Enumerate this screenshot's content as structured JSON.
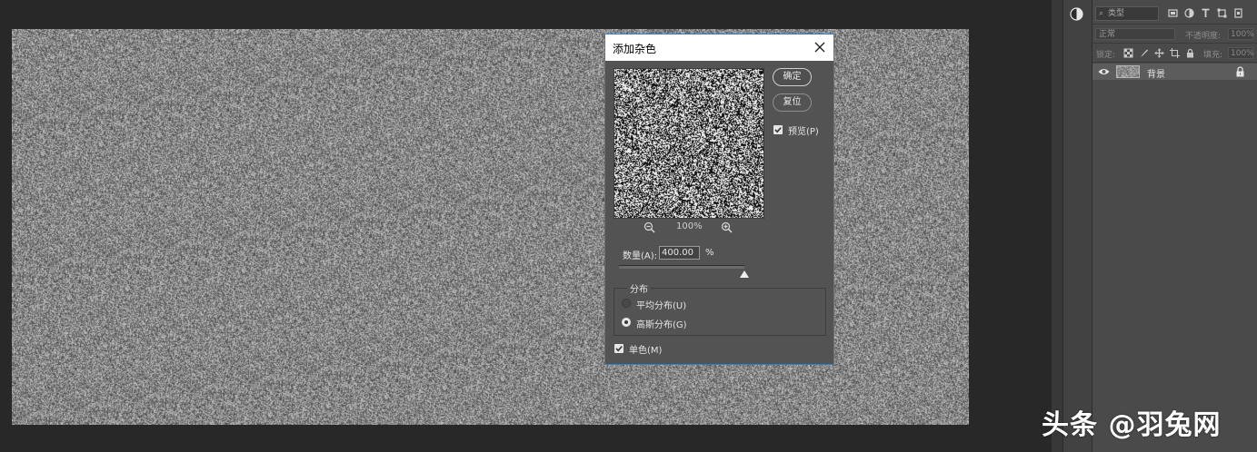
{
  "dialog": {
    "title": "添加杂色",
    "ok_label": "确定",
    "reset_label": "复位",
    "preview_label": "预览(P)",
    "preview_checked": true,
    "zoom_level": "100%",
    "amount_label": "数量(A):",
    "amount_value": "400.00",
    "amount_unit": "%",
    "amount_slider_fraction": 1.0,
    "distribution": {
      "legend": "分布",
      "uniform_label": "平均分布(U)",
      "gaussian_label": "高斯分布(G)",
      "selected": "gaussian"
    },
    "monochromatic_label": "单色(M)",
    "monochromatic_checked": true
  },
  "layers_panel": {
    "filter_kind": "类型",
    "blend_mode": "正常",
    "opacity_label": "不透明度:",
    "opacity_value": "100%",
    "lock_label": "锁定:",
    "fill_label": "填充:",
    "fill_value": "100%",
    "layers": [
      {
        "name": "背景",
        "visible": true,
        "locked": true
      }
    ]
  },
  "icons": {
    "adjust": "half-circle-icon",
    "close": "close-icon",
    "zoom_out": "zoom-out-icon",
    "zoom_in": "zoom-in-icon",
    "eye": "eye-icon",
    "lock": "lock-icon"
  },
  "colors": {
    "dialog_bg": "#535353",
    "dialog_border": "#2a82c8",
    "workspace_bg": "#282828",
    "panel_bg": "#4a4a4a"
  },
  "watermark": "头条 @羽兔网"
}
